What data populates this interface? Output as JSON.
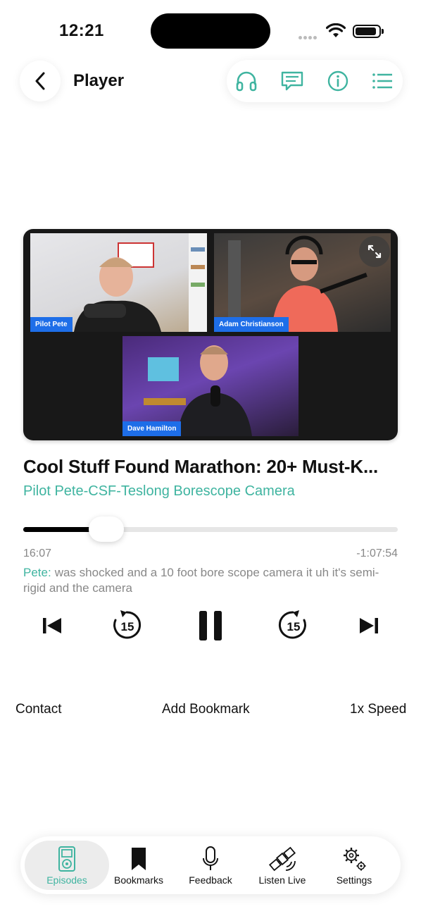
{
  "status_bar": {
    "time": "12:21"
  },
  "header": {
    "title": "Player"
  },
  "toolbar": {
    "icons": [
      "headphones-icon",
      "chat-icon",
      "info-icon",
      "list-icon"
    ],
    "accent": "#3fb4a0"
  },
  "video": {
    "participants": [
      "Pilot Pete",
      "Adam Christianson",
      "Dave Hamilton"
    ],
    "tag_color": "#1e6ee8"
  },
  "episode": {
    "title": "Cool Stuff Found Marathon: 20+ Must-K...",
    "chapter": "Pilot Pete-CSF-Teslong Borescope Camera"
  },
  "playback": {
    "elapsed": "16:07",
    "remaining": "-1:07:54",
    "progress_fraction": 0.19
  },
  "transcript": {
    "speaker": "Pete:",
    "text": "was shocked and a 10 foot bore scope camera it uh it's semi-rigid and the camera"
  },
  "controls": {
    "skip_back_seconds": "15",
    "skip_forward_seconds": "15"
  },
  "actions": {
    "contact": "Contact",
    "bookmark": "Add Bookmark",
    "speed": "1x Speed"
  },
  "tabs": [
    {
      "label": "Episodes",
      "icon": "ipod-icon",
      "active": true
    },
    {
      "label": "Bookmarks",
      "icon": "bookmark-icon",
      "active": false
    },
    {
      "label": "Feedback",
      "icon": "microphone-icon",
      "active": false
    },
    {
      "label": "Listen Live",
      "icon": "satellite-icon",
      "active": false
    },
    {
      "label": "Settings",
      "icon": "gears-icon",
      "active": false
    }
  ],
  "colors": {
    "accent": "#3fb4a0",
    "text": "#111111",
    "muted": "#888888"
  }
}
